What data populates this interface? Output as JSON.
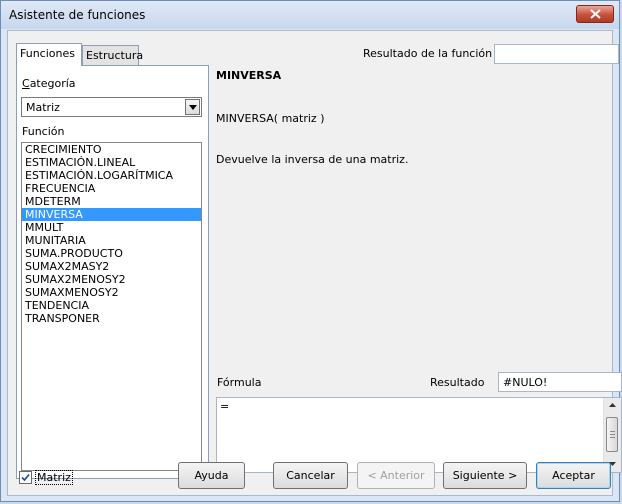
{
  "window": {
    "title": "Asistente de funciones"
  },
  "tabs": [
    {
      "label": "Funciones"
    },
    {
      "label": "Estructura"
    }
  ],
  "category": {
    "label": "Categoría",
    "selected": "Matriz"
  },
  "functions": {
    "label": "Función",
    "items": [
      "CRECIMIENTO",
      "ESTIMACIÓN.LINEAL",
      "ESTIMACIÓN.LOGARÍTMICA",
      "FRECUENCIA",
      "MDETERM",
      "MINVERSA",
      "MMULT",
      "MUNITARIA",
      "SUMA.PRODUCTO",
      "SUMAX2MASY2",
      "SUMAX2MENOSY2",
      "SUMAXMENOSY2",
      "TENDENCIA",
      "TRANSPONER"
    ],
    "selected_index": 5
  },
  "function_result": {
    "label": "Resultado de la función",
    "value": ""
  },
  "details": {
    "name": "MINVERSA",
    "syntax": "MINVERSA( matriz )",
    "description": "Devuelve la inversa de una matriz."
  },
  "formula": {
    "label": "Fórmula",
    "value": "="
  },
  "result": {
    "label": "Resultado",
    "value": "#NULO!"
  },
  "array_checkbox": {
    "label": "Matriz",
    "checked": true
  },
  "buttons": {
    "help": "Ayuda",
    "cancel": "Cancelar",
    "back": "< Anterior",
    "next": "Siguiente >",
    "ok": "Aceptar"
  },
  "colors": {
    "selection": "#3399ff",
    "title_bar": "#c7d7ec",
    "close_button": "#c7503b"
  }
}
